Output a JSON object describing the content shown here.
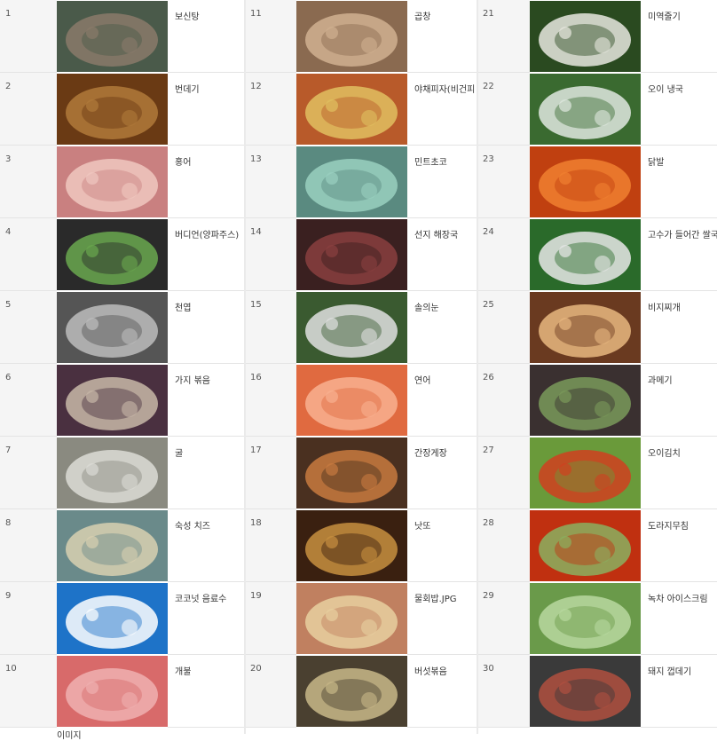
{
  "items": [
    {
      "num": "1",
      "name": "보신탕",
      "c1": "#4a5a4a",
      "c2": "#8a7a6a"
    },
    {
      "num": "2",
      "name": "번데기",
      "c1": "#6a3a14",
      "c2": "#b07a3a"
    },
    {
      "num": "3",
      "name": "홍어",
      "c1": "#c98080",
      "c2": "#f0c8c0"
    },
    {
      "num": "4",
      "name": "버디언(양파주스)",
      "c1": "#2a2a2a",
      "c2": "#6aa84f"
    },
    {
      "num": "5",
      "name": "천엽",
      "c1": "#555555",
      "c2": "#bdbdbd"
    },
    {
      "num": "6",
      "name": "가지 볶음",
      "c1": "#4a3040",
      "c2": "#c8b8a8"
    },
    {
      "num": "7",
      "name": "굴",
      "c1": "#8a8a80",
      "c2": "#dcdcd6"
    },
    {
      "num": "8",
      "name": "숙성 치즈",
      "c1": "#6a8a8a",
      "c2": "#d8d0b0"
    },
    {
      "num": "9",
      "name": "코코넛 음료수",
      "c1": "#1e73c8",
      "c2": "#ffffff"
    },
    {
      "num": "10",
      "name": "개불",
      "c1": "#d86a6a",
      "c2": "#f0b0b0"
    },
    {
      "num": "11",
      "name": "곱창",
      "c1": "#8a6a50",
      "c2": "#d0b090"
    },
    {
      "num": "12",
      "name": "야채피자(비건피",
      "c1": "#b85a2a",
      "c2": "#e0c060"
    },
    {
      "num": "13",
      "name": "민트초코",
      "c1": "#5a8a80",
      "c2": "#9ad0c0"
    },
    {
      "num": "14",
      "name": "선지 해장국",
      "c1": "#3a2020",
      "c2": "#8a4040"
    },
    {
      "num": "15",
      "name": "솔의눈",
      "c1": "#3a5a30",
      "c2": "#e0e0e0"
    },
    {
      "num": "16",
      "name": "연어",
      "c1": "#e06a40",
      "c2": "#f8b090"
    },
    {
      "num": "17",
      "name": "간장게장",
      "c1": "#4a3020",
      "c2": "#c87a40"
    },
    {
      "num": "18",
      "name": "낫또",
      "c1": "#3a2010",
      "c2": "#c89040"
    },
    {
      "num": "19",
      "name": "물회밥.JPG",
      "c1": "#c08060",
      "c2": "#e8d0a0"
    },
    {
      "num": "20",
      "name": "버섯볶음",
      "c1": "#4a4030",
      "c2": "#c8b888"
    },
    {
      "num": "21",
      "name": "미역줄기",
      "c1": "#2a4a20",
      "c2": "#e8e8e0"
    },
    {
      "num": "22",
      "name": "오이 냉국",
      "c1": "#3a6a30",
      "c2": "#e0e8e0"
    },
    {
      "num": "23",
      "name": "닭발",
      "c1": "#c04010",
      "c2": "#f08030"
    },
    {
      "num": "24",
      "name": "고수가 들어간 쌀국수",
      "c1": "#2a6a2a",
      "c2": "#e8e8e8"
    },
    {
      "num": "25",
      "name": "비지찌개",
      "c1": "#6a3a20",
      "c2": "#e8b880"
    },
    {
      "num": "26",
      "name": "과메기",
      "c1": "#3a3030",
      "c2": "#7a9a5a"
    },
    {
      "num": "27",
      "name": "오이김치",
      "c1": "#6a9a3a",
      "c2": "#d04020"
    },
    {
      "num": "28",
      "name": "도라지무침",
      "c1": "#c03010",
      "c2": "#8ab060"
    },
    {
      "num": "29",
      "name": "녹차 아이스크림",
      "c1": "#6a9a4a",
      "c2": "#b8d8a0"
    },
    {
      "num": "30",
      "name": "돼지 껍데기",
      "c1": "#3a3a3a",
      "c2": "#b05040"
    }
  ],
  "tail_text": "이미지"
}
